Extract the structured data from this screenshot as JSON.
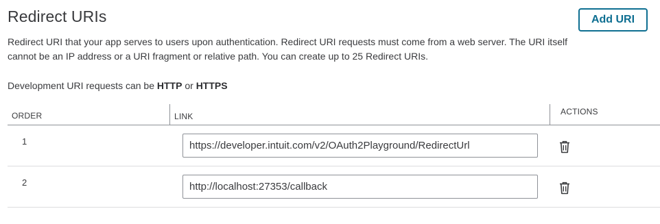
{
  "header": {
    "title": "Redirect URIs",
    "add_button_label": "Add URI"
  },
  "description": "Redirect URI that your app serves to users upon authentication. Redirect URI requests must come from a web server. The URI itself cannot be an IP address or a URI fragment or relative path. You can create up to 25 Redirect URIs.",
  "dev_note": {
    "prefix": "Development URI requests can be ",
    "http": "HTTP",
    "joiner": " or ",
    "https": "HTTPS"
  },
  "table": {
    "columns": {
      "order": "ORDER",
      "link": "LINK",
      "actions": "ACTIONS"
    },
    "rows": [
      {
        "order": "1",
        "link": "https://developer.intuit.com/v2/OAuth2Playground/RedirectUrl",
        "action_icon": "trash-icon"
      },
      {
        "order": "2",
        "link": "http://localhost:27353/callback",
        "action_icon": "trash-icon"
      }
    ]
  },
  "colors": {
    "accent": "#0d6e91",
    "text": "#393a3d",
    "divider": "#8d9096"
  }
}
